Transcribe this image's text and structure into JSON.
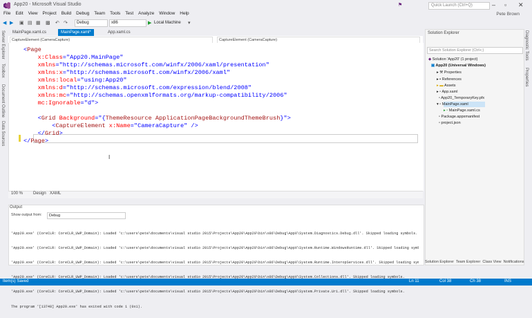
{
  "window": {
    "title": "App20 - Microsoft Visual Studio",
    "quick_launch_placeholder": "Quick Launch (Ctrl+Q)",
    "user": "Pete Brown"
  },
  "menu": [
    "File",
    "Edit",
    "View",
    "Project",
    "Build",
    "Debug",
    "Team",
    "Tools",
    "Test",
    "Analyze",
    "Window",
    "Help"
  ],
  "toolbar": {
    "config": "Debug",
    "platform": "x86",
    "run_target": "Local Machine"
  },
  "left_tabs": [
    "Server Explorer",
    "Toolbox",
    "Document Outline",
    "Data Sources"
  ],
  "right_tabs": [
    "Diagnostic Tools",
    "Properties"
  ],
  "doc_tabs": [
    "MainPage.xaml.cs",
    "MainPage.xaml*",
    "App.xaml.cs"
  ],
  "nav": {
    "left": "CaptureElement (CameraCapture)",
    "right": "CaptureElement (CameraCapture)"
  },
  "code": [
    [
      [
        "<",
        "p"
      ],
      [
        "Page",
        "t"
      ]
    ],
    [
      [
        "    ",
        ""
      ],
      [
        "x:Class",
        "a"
      ],
      [
        "=\"App20.MainPage\"",
        "v"
      ]
    ],
    [
      [
        "    ",
        ""
      ],
      [
        "xmlns",
        "a"
      ],
      [
        "=\"http://schemas.microsoft.com/winfx/2006/xaml/presentation\"",
        "v"
      ]
    ],
    [
      [
        "    ",
        ""
      ],
      [
        "xmlns:x",
        "a"
      ],
      [
        "=\"http://schemas.microsoft.com/winfx/2006/xaml\"",
        "v"
      ]
    ],
    [
      [
        "    ",
        ""
      ],
      [
        "xmlns:local",
        "a"
      ],
      [
        "=\"using:App20\"",
        "v"
      ]
    ],
    [
      [
        "    ",
        ""
      ],
      [
        "xmlns:d",
        "a"
      ],
      [
        "=\"http://schemas.microsoft.com/expression/blend/2008\"",
        "v"
      ]
    ],
    [
      [
        "    ",
        ""
      ],
      [
        "xmlns:mc",
        "a"
      ],
      [
        "=\"http://schemas.openxmlformats.org/markup-compatibility/2006\"",
        "v"
      ]
    ],
    [
      [
        "    ",
        ""
      ],
      [
        "mc:Ignorable",
        "a"
      ],
      [
        "=\"d\"",
        "v"
      ],
      [
        ">",
        "p"
      ]
    ],
    [
      [
        "",
        ""
      ]
    ],
    [
      [
        "    ",
        ""
      ],
      [
        "<",
        "p"
      ],
      [
        "Grid",
        "t"
      ],
      [
        " Background",
        "a"
      ],
      [
        "=\"{",
        "v"
      ],
      [
        "ThemeResource ApplicationPageBackgroundThemeBrush",
        "t"
      ],
      [
        "}\"",
        "v"
      ],
      [
        ">",
        "p"
      ]
    ],
    [
      [
        "        ",
        ""
      ],
      [
        "<",
        "p"
      ],
      [
        "CaptureElement",
        "t"
      ],
      [
        " x:Name",
        "a"
      ],
      [
        "=\"CameraCapture\"",
        "v"
      ],
      [
        " />",
        "p"
      ]
    ],
    [
      [
        "    ",
        ""
      ],
      [
        "</",
        "p"
      ],
      [
        "Grid",
        "t"
      ],
      [
        ">",
        "p"
      ]
    ],
    [
      [
        "</",
        "p"
      ],
      [
        "Page",
        "t"
      ],
      [
        ">",
        "p"
      ]
    ]
  ],
  "split": {
    "zoom": "100 %",
    "design": "Design",
    "xaml": "XAML"
  },
  "output": {
    "title": "Output",
    "show_from_label": "Show output from:",
    "show_from_value": "Debug",
    "lines": [
      "'App20.exe' (CoreCLR: CoreCLR_UWP_Domain): Loaded 'c:\\users\\pete\\documents\\visual studio 2015\\Projects\\App20\\App20\\bin\\x86\\Debug\\AppX\\System.Diagnostics.Debug.dll'. Skipped loading symbols.",
      "'App20.exe' (CoreCLR: CoreCLR_UWP_Domain): Loaded 'c:\\users\\pete\\documents\\visual studio 2015\\Projects\\App20\\App20\\bin\\x86\\Debug\\AppX\\System.Runtime.WindowsRuntime.dll'. Skipped loading symbols.",
      "'App20.exe' (CoreCLR: CoreCLR_UWP_Domain): Loaded 'c:\\users\\pete\\documents\\visual studio 2015\\Projects\\App20\\App20\\bin\\x86\\Debug\\AppX\\System.Runtime.InteropServices.dll'. Skipped loading symbols.",
      "'App20.exe' (CoreCLR: CoreCLR_UWP_Domain): Loaded 'c:\\users\\pete\\documents\\visual studio 2015\\Projects\\App20\\App20\\bin\\x86\\Debug\\AppX\\System.Collections.dll'. Skipped loading symbols.",
      "'App20.exe' (CoreCLR: CoreCLR_UWP_Domain): Loaded 'c:\\users\\pete\\documents\\visual studio 2015\\Projects\\App20\\App20\\bin\\x86\\Debug\\AppX\\System.Private.Uri.dll'. Skipped loading symbols.",
      "The program '[13748] App20.exe' has exited with code 1 (0x1)."
    ]
  },
  "solution": {
    "title": "Solution Explorer",
    "search_placeholder": "Search Solution Explorer (Ctrl+;)",
    "items": [
      {
        "label": "Solution 'App20' (1 project)",
        "indent": 0
      },
      {
        "label": "App20 (Universal Windows)",
        "indent": 1
      },
      {
        "label": "Properties",
        "indent": 2
      },
      {
        "label": "References",
        "indent": 2
      },
      {
        "label": "Assets",
        "indent": 2
      },
      {
        "label": "App.xaml",
        "indent": 2
      },
      {
        "label": "App20_TemporaryKey.pfx",
        "indent": 2
      },
      {
        "label": "MainPage.xaml",
        "indent": 2
      },
      {
        "label": "MainPage.xaml.cs",
        "indent": 3
      },
      {
        "label": "Package.appxmanifest",
        "indent": 2
      },
      {
        "label": "project.json",
        "indent": 2
      }
    ],
    "bottom_tabs": [
      "Solution Explorer",
      "Team Explorer",
      "Class View",
      "Notifications"
    ]
  },
  "status": {
    "left": "Item(s) Saved",
    "ln": "Ln 11",
    "col": "Col 38",
    "ch": "Ch 38",
    "mode": "INS"
  },
  "colors": {
    "accent": "#007acc",
    "tag": "#a31515",
    "attr": "#ff0000",
    "value": "#0000ff"
  }
}
